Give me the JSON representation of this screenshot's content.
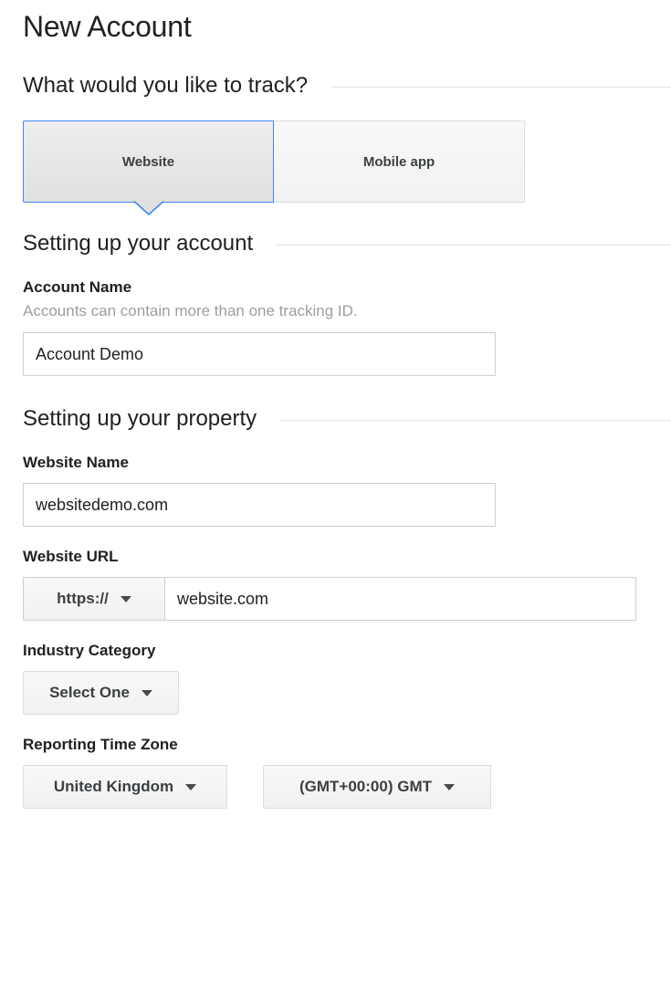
{
  "page": {
    "title": "New Account"
  },
  "track_section": {
    "heading": "What would you like to track?",
    "tabs": [
      {
        "label": "Website",
        "active": true
      },
      {
        "label": "Mobile app",
        "active": false
      }
    ]
  },
  "account_section": {
    "heading": "Setting up your account",
    "account_name": {
      "label": "Account Name",
      "hint": "Accounts can contain more than one tracking ID.",
      "value": "Account Demo",
      "placeholder": ""
    }
  },
  "property_section": {
    "heading": "Setting up your property",
    "website_name": {
      "label": "Website Name",
      "value": "websitedemo.com",
      "placeholder": ""
    },
    "website_url": {
      "label": "Website URL",
      "protocol": "https://",
      "value": "website.com",
      "placeholder": ""
    },
    "industry_category": {
      "label": "Industry Category",
      "value": "Select One"
    },
    "reporting_time_zone": {
      "label": "Reporting Time Zone",
      "country": "United Kingdom",
      "zone": "(GMT+00:00) GMT"
    }
  },
  "icons": {
    "caret": "chevron-down-icon"
  },
  "colors": {
    "accent_blue": "#4285f4",
    "text_primary": "#212121",
    "text_hint": "#9e9e9e",
    "border_gray": "#cfcfcf",
    "divider": "#e4e4e4"
  }
}
